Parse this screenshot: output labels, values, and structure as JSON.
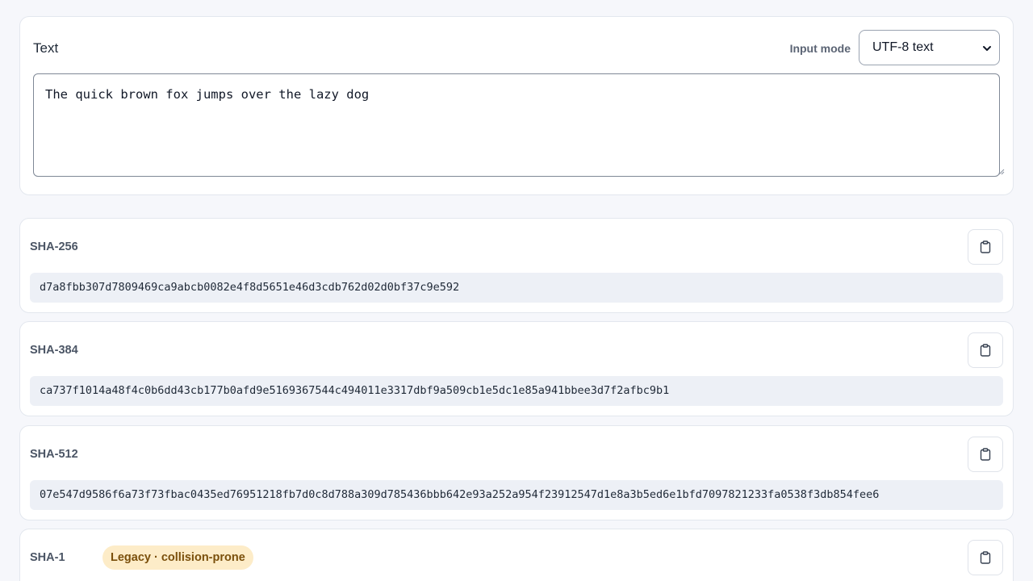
{
  "input": {
    "title": "Text",
    "mode_label": "Input mode",
    "mode_value": "UTF-8 text",
    "text": "The quick brown fox jumps over the lazy dog"
  },
  "hashes": [
    {
      "name": "SHA-256",
      "digest": "d7a8fbb307d7809469ca9abcb0082e4f8d5651e46d3cdb762d02d0bf37c9e592",
      "copy_icon": "clipboard-icon"
    },
    {
      "name": "SHA-384",
      "digest": "ca737f1014a48f4c0b6dd43cb177b0afd9e5169367544c494011e3317dbf9a509cb1e5dc1e85a941bbee3d7f2afbc9b1",
      "copy_icon": "clipboard-icon"
    },
    {
      "name": "SHA-512",
      "digest": "07e547d9586f6a73f73fbac0435ed76951218fb7d0c8d788a309d785436bbb642e93a252a954f23912547d1e8a3b5ed6e1bfd7097821233fa0538f3db854fee6",
      "copy_icon": "clipboard-icon"
    },
    {
      "name": "SHA-1",
      "badge": "Legacy · collision-prone",
      "copy_icon": "clipboard-icon"
    }
  ],
  "colors": {
    "page_bg": "#f6f7fb",
    "digest_bg": "#edf0f6",
    "badge_bg": "#fdecc8",
    "badge_text": "#7a4f0b"
  }
}
